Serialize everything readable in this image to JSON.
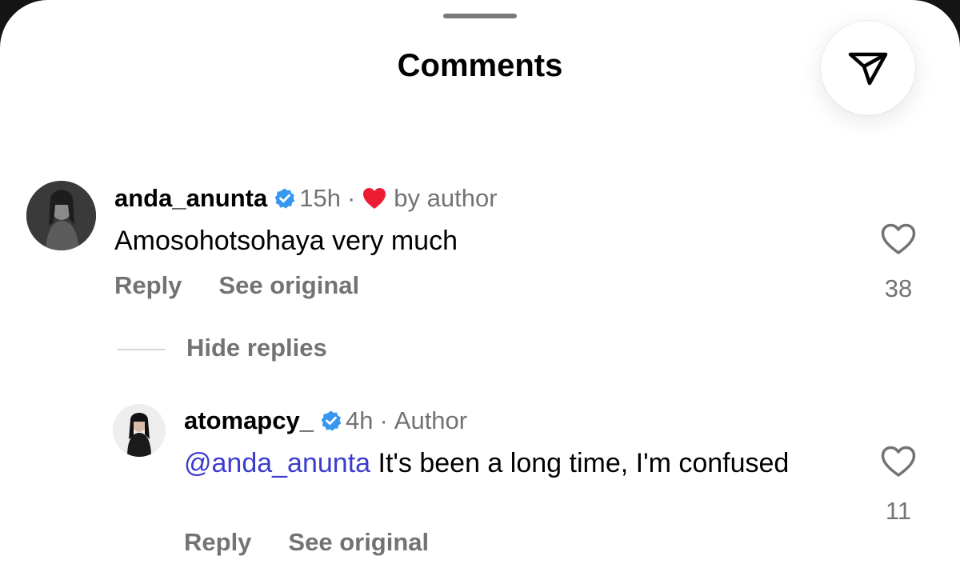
{
  "header": {
    "title": "Comments",
    "share_icon": "send-paper-plane-icon"
  },
  "comments": [
    {
      "username": "anda_anunta",
      "verified": true,
      "time": "15h",
      "separator": "·",
      "liked_by_author_label": "by author",
      "text": "Amosohotsohaya very much",
      "reply_label": "Reply",
      "see_original_label": "See original",
      "like_count": "38",
      "hide_replies_label": "Hide replies",
      "replies": [
        {
          "username": "atomapcy_",
          "verified": true,
          "time": "4h",
          "separator": "·",
          "role": "Author",
          "mention": "@anda_anunta",
          "text": " It's been a long time, I'm confused",
          "reply_label": "Reply",
          "see_original_label": "See original",
          "like_count": "11"
        }
      ]
    }
  ],
  "colors": {
    "verified_badge": "#3797f0",
    "heart_red": "#ed1c33",
    "mention": "#3b3ccf",
    "secondary_text": "#737373"
  }
}
